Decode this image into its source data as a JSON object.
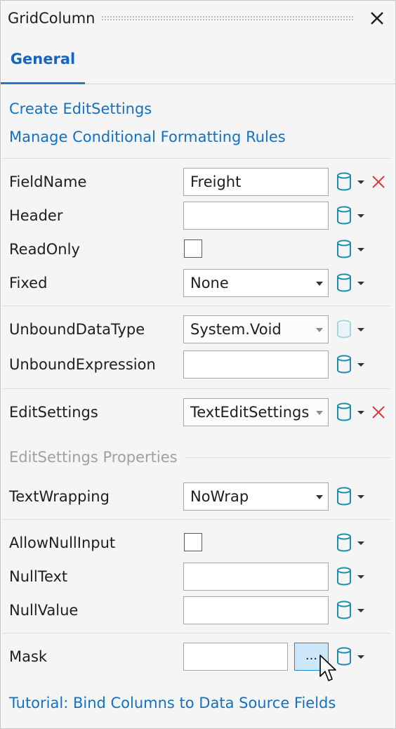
{
  "window": {
    "title": "GridColumn"
  },
  "tabs": [
    {
      "label": "General",
      "active": true
    }
  ],
  "links": {
    "create_editsettings": "Create EditSettings",
    "manage_rules": "Manage Conditional Formatting Rules",
    "tutorial": "Tutorial: Bind Columns to Data Source Fields"
  },
  "properties": {
    "field_name": {
      "label": "FieldName",
      "value": "Freight"
    },
    "header": {
      "label": "Header",
      "value": ""
    },
    "read_only": {
      "label": "ReadOnly",
      "checked": false
    },
    "fixed": {
      "label": "Fixed",
      "value": "None"
    },
    "unbound_data_type": {
      "label": "UnboundDataType",
      "value": "System.Void"
    },
    "unbound_expression": {
      "label": "UnboundExpression",
      "value": ""
    },
    "edit_settings": {
      "label": "EditSettings",
      "value": "TextEditSettings"
    },
    "edit_settings_section": "EditSettings Properties",
    "text_wrapping": {
      "label": "TextWrapping",
      "value": "NoWrap"
    },
    "allow_null_input": {
      "label": "AllowNullInput",
      "checked": false
    },
    "null_text": {
      "label": "NullText",
      "value": ""
    },
    "null_value": {
      "label": "NullValue",
      "value": ""
    },
    "mask": {
      "label": "Mask",
      "value": "",
      "button_label": "..."
    }
  },
  "colors": {
    "accent": "#1f7ad4",
    "link": "#1271c4",
    "db_icon": "#1a8fb0",
    "clear_icon": "#d93a3a",
    "button_fill": "#cde8f9"
  }
}
